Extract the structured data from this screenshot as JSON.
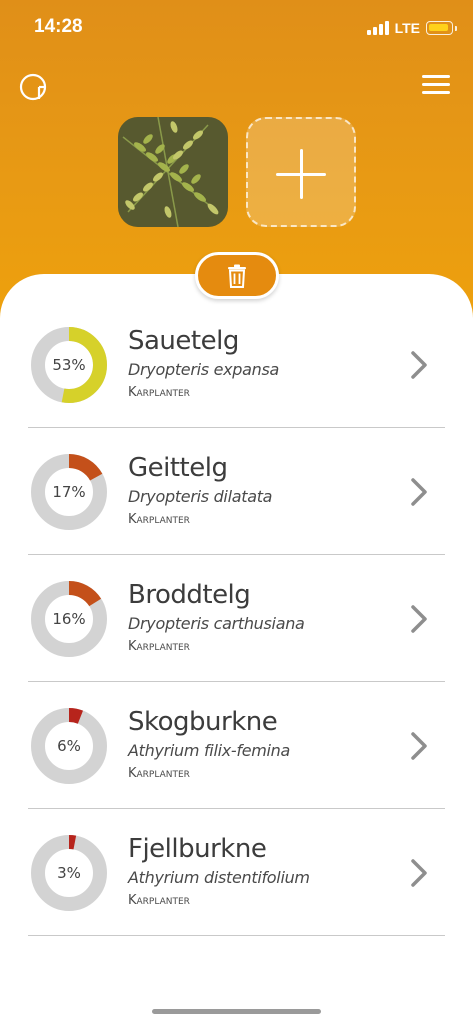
{
  "status": {
    "time": "14:28",
    "network": "LTE"
  },
  "header": {
    "logo_icon": "circle-logo-icon",
    "menu_icon": "hamburger-menu-icon",
    "photo": "fern-photo",
    "add_icon": "plus-icon",
    "delete_icon": "trash-icon"
  },
  "colors": {
    "header_top": "#e08f18",
    "header_bottom": "#eea10c",
    "ring_track": "#d3d3d3",
    "ring_high": "#d6d12a",
    "ring_mid": "#c4501a",
    "ring_low": "#b7241c"
  },
  "results": [
    {
      "name": "Sauetelg",
      "latin": "Dryopteris expansa",
      "group": "Karplanter",
      "percent_label": "53%",
      "percent": 53,
      "color": "#d6d12a"
    },
    {
      "name": "Geittelg",
      "latin": "Dryopteris dilatata",
      "group": "Karplanter",
      "percent_label": "17%",
      "percent": 17,
      "color": "#c4501a"
    },
    {
      "name": "Broddtelg",
      "latin": "Dryopteris carthusiana",
      "group": "Karplanter",
      "percent_label": "16%",
      "percent": 16,
      "color": "#c4501a"
    },
    {
      "name": "Skogburkne",
      "latin": "Athyrium filix-femina",
      "group": "Karplanter",
      "percent_label": "6%",
      "percent": 6,
      "color": "#b7241c"
    },
    {
      "name": "Fjellburkne",
      "latin": "Athyrium distentifolium",
      "group": "Karplanter",
      "percent_label": "3%",
      "percent": 3,
      "color": "#b7241c"
    }
  ]
}
